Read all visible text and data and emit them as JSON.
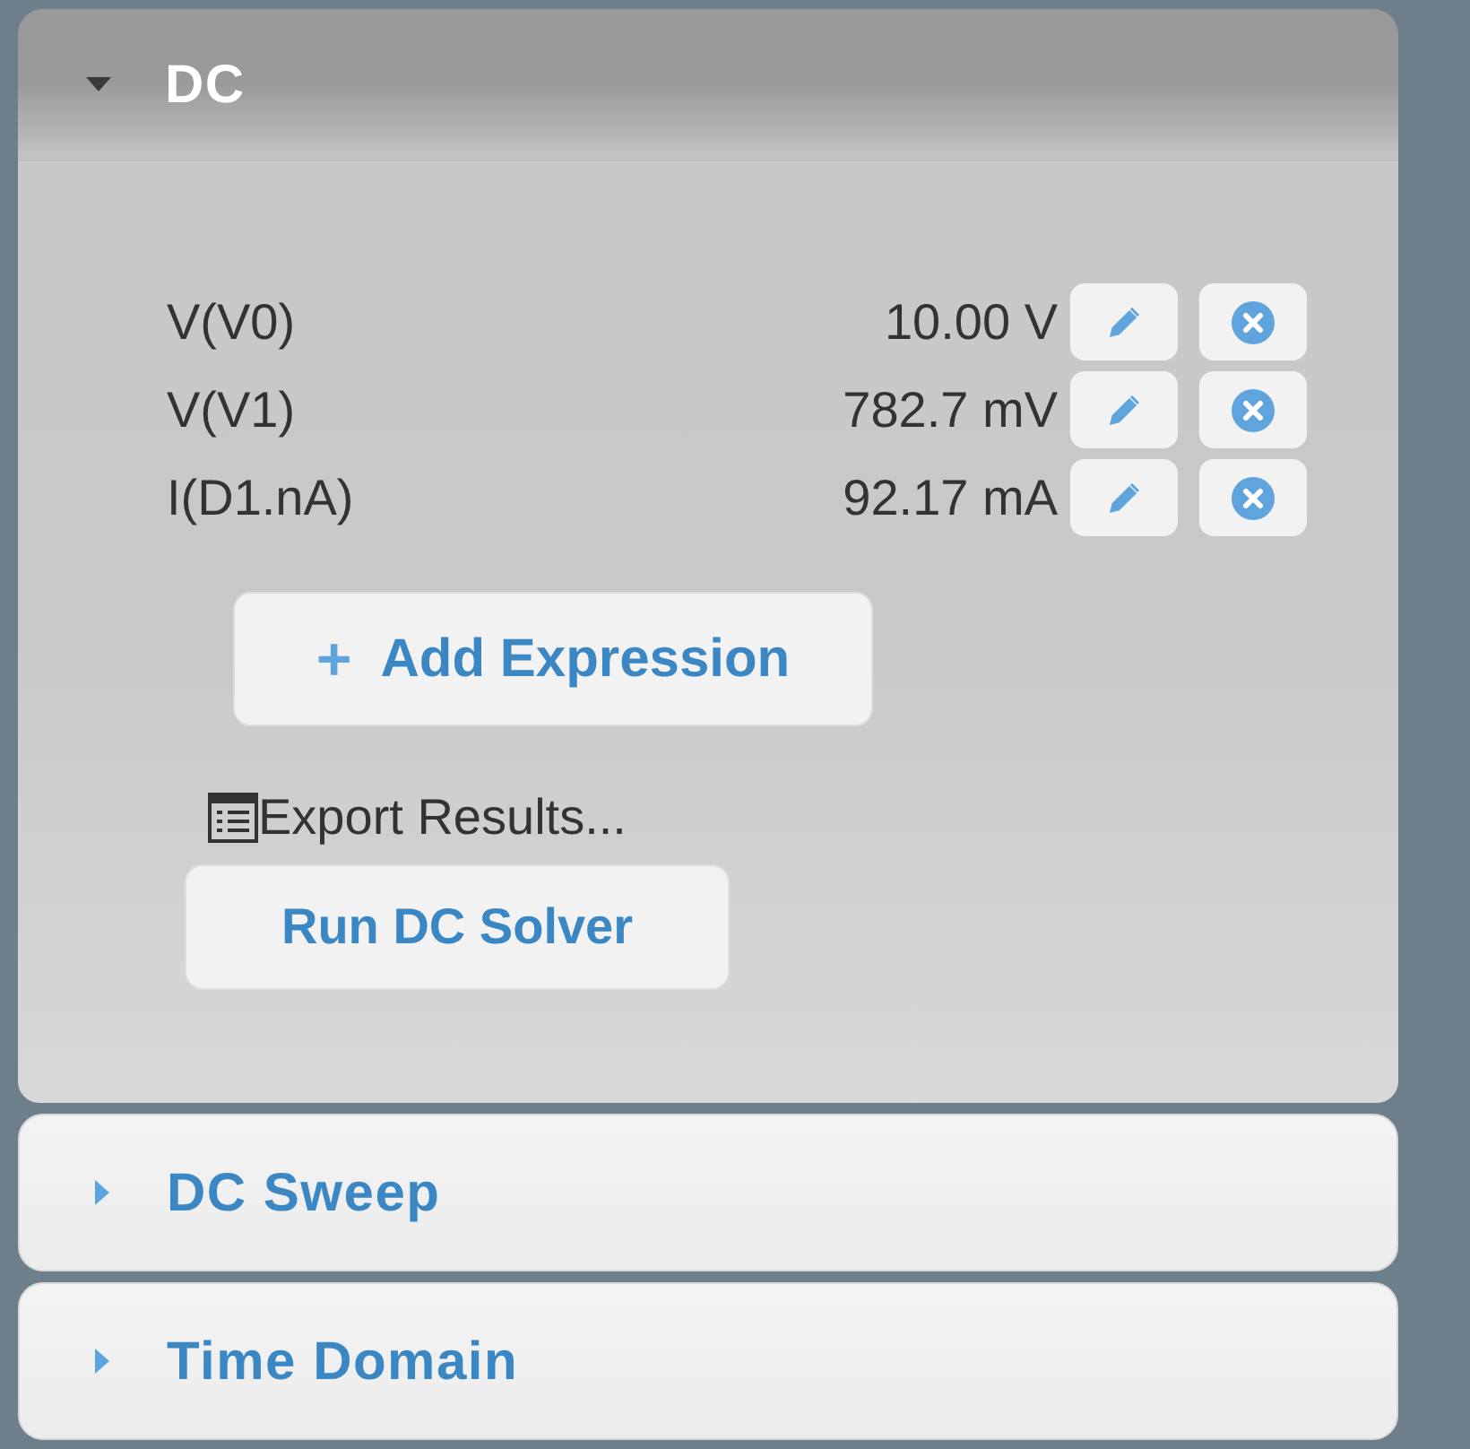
{
  "sections": [
    {
      "title": "DC",
      "expanded": true,
      "expressions": [
        {
          "name": "V(V0)",
          "value": "10.00 V"
        },
        {
          "name": "V(V1)",
          "value": "782.7 mV"
        },
        {
          "name": "I(D1.nA)",
          "value": "92.17 mA"
        }
      ],
      "add_button": {
        "icon": "+",
        "label": "Add Expression"
      },
      "export_link": "Export Results...",
      "run_button": "Run DC Solver"
    },
    {
      "title": "DC Sweep",
      "expanded": false
    },
    {
      "title": "Time Domain",
      "expanded": false
    }
  ]
}
